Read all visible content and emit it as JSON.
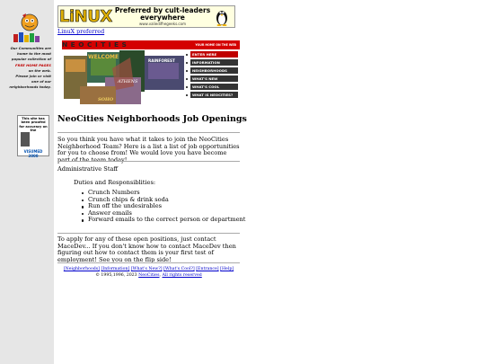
{
  "sidebar": {
    "blurb_line1": "Our Communities are",
    "blurb_line2": "home to the most",
    "blurb_line3": "popular collection of",
    "blurb_highlight": "FREE HOME PAGES",
    "blurb_line4": "on the web.",
    "blurb_line5": "Please join or visit",
    "blurb_line6": "one of our",
    "blurb_line7": "neighborhoods today.",
    "proofed_text": "This site has been proofed for accuracy on the",
    "proofed_badge": "VISUMED 3000"
  },
  "banner": {
    "logo_text": "LiNUX",
    "tagline": "Preferred by cult-leaders everywhere",
    "url_text": "www.valiedifhegeeks.com",
    "link_text": "LinuX preferred"
  },
  "neo_header": {
    "title": "NEOCITIES",
    "subtitle": "YOUR HOME ON THE WEB"
  },
  "collage": {
    "caption_welcome": "WELCOME",
    "caption_rainforest": "RAINFOREST",
    "caption_athens": "ATHENS",
    "caption_soho": "SOHO"
  },
  "nav": {
    "items": [
      {
        "label": "ENTER HERE"
      },
      {
        "label": "INFORMATION"
      },
      {
        "label": "NEIGHBORHOODS"
      },
      {
        "label": "WHAT'S NEW"
      },
      {
        "label": "WHAT'S COOL"
      },
      {
        "label": "WHAT IS NEOCITIES?"
      }
    ]
  },
  "content": {
    "title": "NeoCities Neighborhoods Job Openings",
    "intro": "So you think you have what it takes to join the NeoCities Neighborhood Team? Here is a list a list of job opportunities for you to choose from! We would love you have become part of the team today!",
    "position_heading": "Administrative Staff",
    "duties_label": "Duties and Responsiblities:",
    "duties": [
      "Crunch Numbers",
      "Crunch chips & drink soda",
      "Run off the undesirables",
      "Answer emails",
      "Forward emails to the correct person or department"
    ],
    "apply_text": "To apply for any of these open positions, just contact MaceDev... If you don't know how to contact MaceDev then figuring out how to contact them is your first test of employment! See you on the flip side!"
  },
  "footer": {
    "links": [
      "[Neighborhoods]",
      "[Information]",
      "[What's New?]",
      "[What's Cool?]",
      "[Entrance]",
      "[Help]"
    ],
    "copyright_prefix": "© 1995,1996, 2023",
    "copyright_link": "NeoCities",
    "rights_link": "All rights reserved"
  },
  "colors": {
    "sidebar_bg": "#e6e6e6",
    "link": "#0000cc",
    "neo_red": "#d40000",
    "nav_dark": "#333333"
  }
}
